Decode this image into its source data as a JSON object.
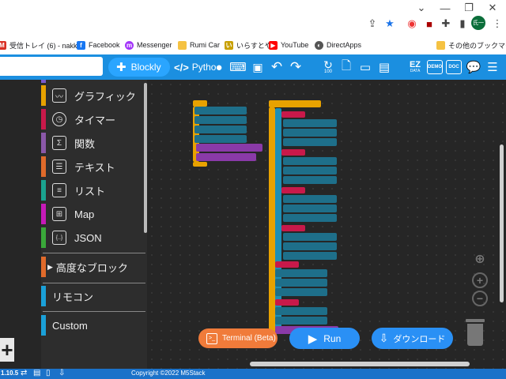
{
  "browser": {
    "profile_initial": "氏一",
    "bookmarks": [
      {
        "label": "受信トレイ (6) - nakk...",
        "icon_color": "#d93025",
        "icon_char": "M"
      },
      {
        "label": "Facebook",
        "icon_color": "#1877f2",
        "icon_char": "f"
      },
      {
        "label": "Messenger",
        "icon_color": "#a334fa",
        "icon_char": "m"
      },
      {
        "label": "Rumi Car",
        "icon_color": "#f5c242",
        "icon_char": ""
      },
      {
        "label": "いらすとや",
        "icon_color": "#c8a000",
        "icon_char": "い"
      },
      {
        "label": "YouTube",
        "icon_color": "#ff0000",
        "icon_char": "▶"
      },
      {
        "label": "DirectApps",
        "icon_color": "#555555",
        "icon_char": "◐"
      }
    ],
    "other_bookmarks": "その他のブックマーク"
  },
  "toolbar": {
    "tab_blockly": "Blockly",
    "tab_python": "Pytho",
    "ez_data_top": "EZ",
    "ez_data_bottom": "DATA",
    "demo_label": "DEMO",
    "doc_label": "DOC",
    "counter_label": "100"
  },
  "sidebar": {
    "categories": [
      {
        "label": "グラフィック",
        "color": "#e8a200",
        "icon": "graphic-icon",
        "glyph": "〰"
      },
      {
        "label": "タイマー",
        "color": "#c8194a",
        "icon": "timer-icon",
        "glyph": "◷"
      },
      {
        "label": "関数",
        "color": "#8a58a8",
        "icon": "function-icon",
        "glyph": "Σ"
      },
      {
        "label": "テキスト",
        "color": "#e06a2a",
        "icon": "text-icon",
        "glyph": "☰"
      },
      {
        "label": "リスト",
        "color": "#1aa38f",
        "icon": "list-icon",
        "glyph": "≡"
      },
      {
        "label": "Map",
        "color": "#c61ab8",
        "icon": "map-icon",
        "glyph": "⊞"
      },
      {
        "label": "JSON",
        "color": "#3aa83a",
        "icon": "json-icon",
        "glyph": "{..}"
      }
    ],
    "advanced": {
      "label": "高度なブロック",
      "color": "#e06a2a"
    },
    "remote": {
      "label": "リモコン",
      "color": "#1aa0d8"
    },
    "custom": {
      "label": "Custom",
      "color": "#1aa0d8"
    }
  },
  "buttons": {
    "terminal": "Terminal (Beta)",
    "run": "Run",
    "download": "ダウンロード"
  },
  "status": {
    "version": "1.10.5",
    "copyright": "Copyright ©2022 M5Stack"
  }
}
